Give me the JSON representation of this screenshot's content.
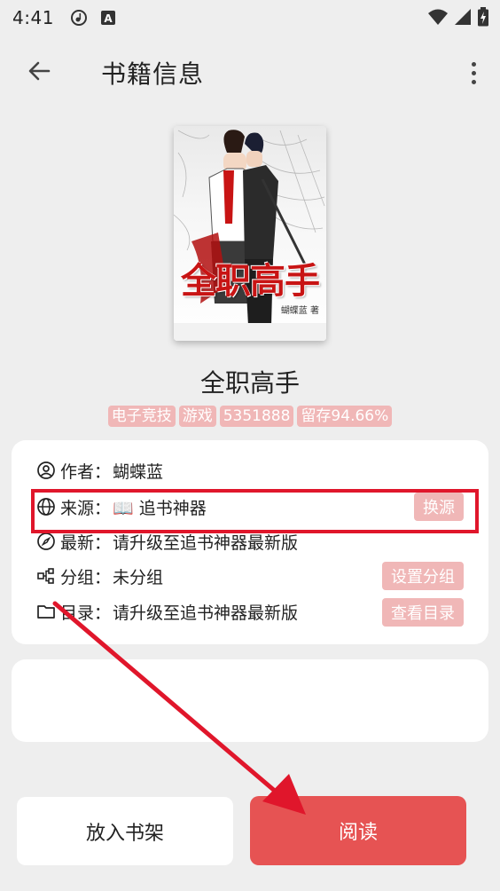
{
  "status_bar": {
    "time": "4:41",
    "icons": [
      "music-icon",
      "a-notification-icon",
      "wifi-icon",
      "signal-icon",
      "battery-icon"
    ]
  },
  "app_bar": {
    "title": "书籍信息",
    "back_icon": "arrow-left-icon",
    "more_icon": "more-vertical-icon"
  },
  "cover": {
    "title": "全职高手",
    "author_caption": "蝴蝶蓝 著"
  },
  "book": {
    "name": "全职高手",
    "tags": [
      "电子竞技",
      "游戏",
      "5351888",
      "留存94.66%"
    ]
  },
  "info": {
    "author_label": "作者：",
    "author_value": "蝴蝶蓝",
    "source_label": "来源：",
    "source_value": "📖 追书神器",
    "source_button": "换源",
    "latest_label": "最新：",
    "latest_value": "请升级至追书神器最新版",
    "group_label": "分组：",
    "group_value": "未分组",
    "group_button": "设置分组",
    "toc_label": "目录：",
    "toc_value": "请升级至追书神器最新版",
    "toc_button": "查看目录"
  },
  "actions": {
    "add_to_shelf": "放入书架",
    "read": "阅读"
  },
  "colors": {
    "accent": "#e65353",
    "tag_bg": "#f0b7b7",
    "highlight": "#e0162b",
    "background": "#eeeeee"
  }
}
